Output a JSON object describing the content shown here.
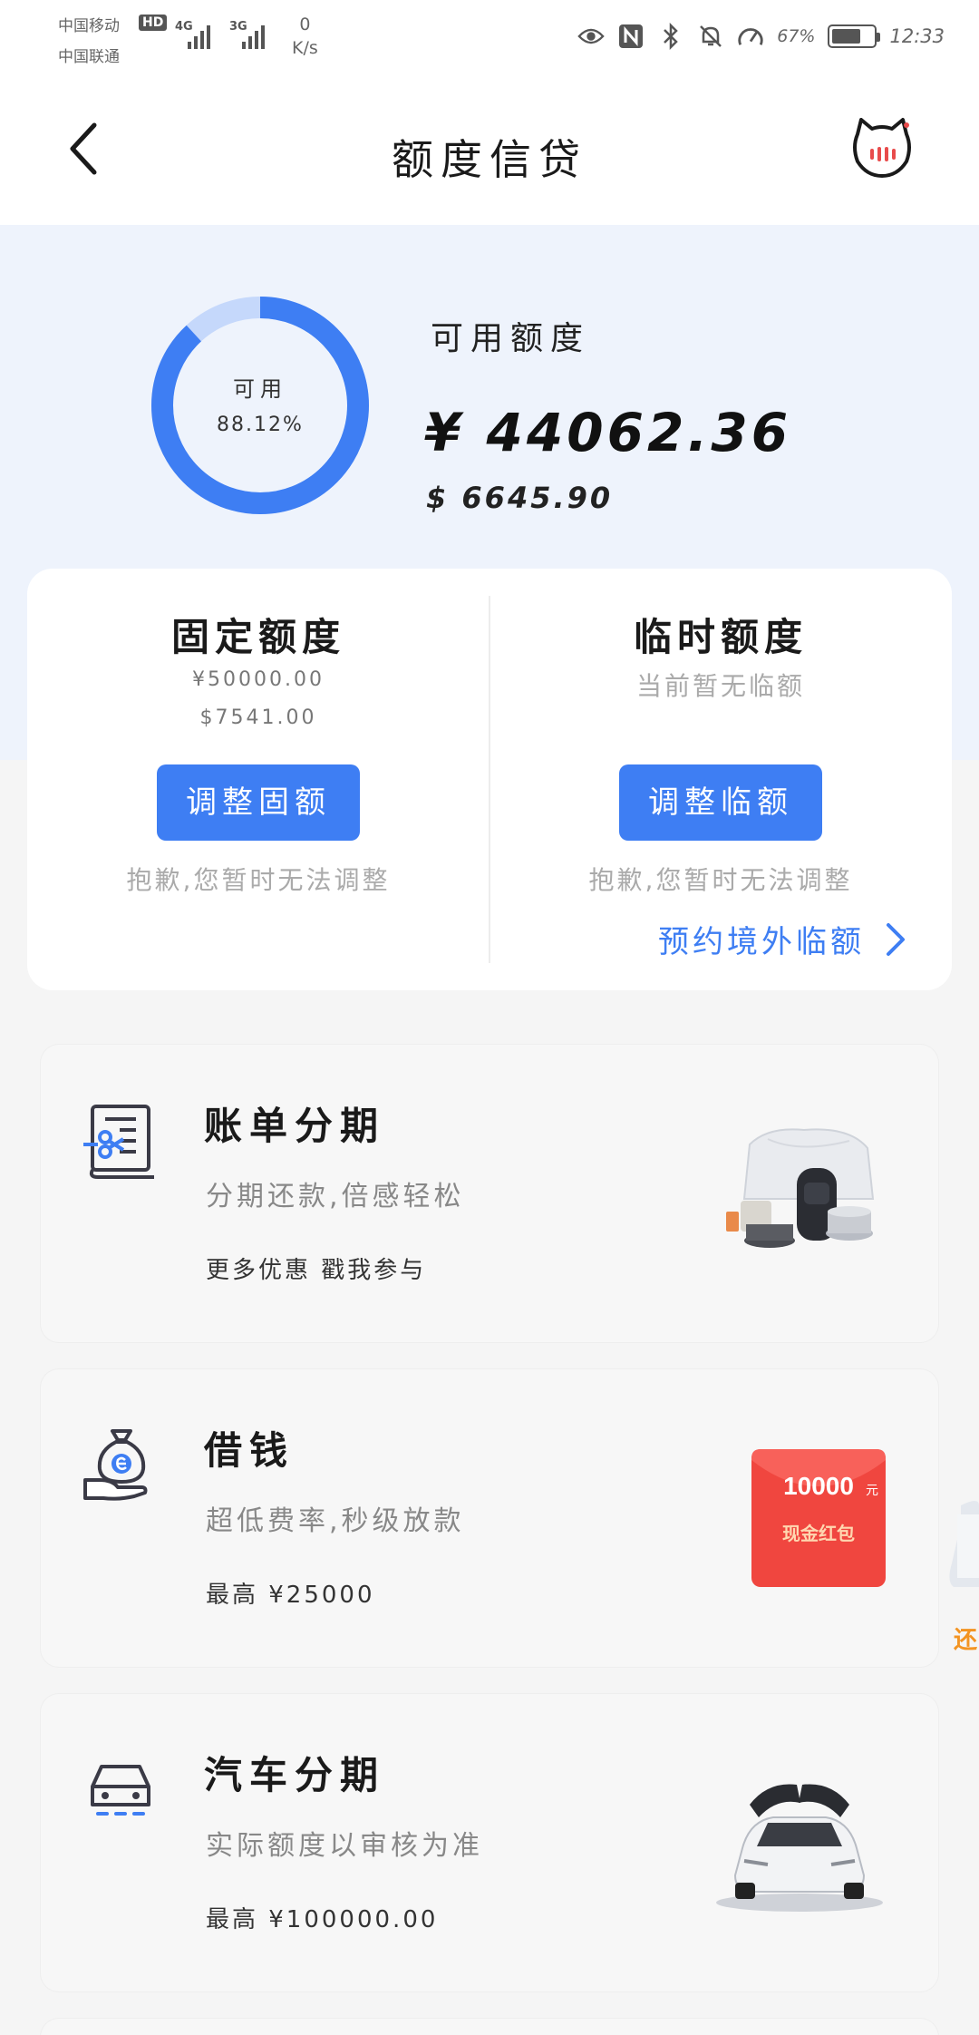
{
  "status_bar": {
    "carrier_1": "中国移动",
    "carrier_2": "中国联通",
    "hd_badge": "HD",
    "signal_1_label": "4G",
    "signal_2_label": "3G",
    "net_speed_value": "0",
    "net_speed_unit": "K/s",
    "battery_percent": "67%",
    "battery_level": 0.67,
    "time": "12:33",
    "icons": [
      "eye-icon",
      "nfc-icon",
      "bluetooth-icon",
      "mute-icon",
      "speed-icon",
      "battery-icon"
    ]
  },
  "header": {
    "title": "额度信贷",
    "back_icon": "chevron-left-icon",
    "mascot_icon": "cat-mascot-icon"
  },
  "summary": {
    "gauge_label": "可用",
    "gauge_percent": "88.12%",
    "gauge_value": 0.8812,
    "available_title": "可用额度",
    "available_cny": "¥ 44062.36",
    "available_usd": "$ 6645.90",
    "colors": {
      "accent": "#3e7ef3",
      "track": "#c5d8fb"
    }
  },
  "quota": {
    "fixed": {
      "title": "固定额度",
      "cny": "¥50000.00",
      "usd": "$7541.00",
      "button": "调整固额",
      "note": "抱歉,您暂时无法调整"
    },
    "temporary": {
      "title": "临时额度",
      "status": "当前暂无临额",
      "button": "调整临额",
      "note": "抱歉,您暂时无法调整",
      "overseas_link": "预约境外临额"
    }
  },
  "products": [
    {
      "title": "账单分期",
      "desc": "分期还款,倍感轻松",
      "meta": "更多优惠 戳我参与",
      "icon": "bill-installment-icon",
      "image": "home-goods-image"
    },
    {
      "title": "借钱",
      "desc": "超低费率,秒级放款",
      "meta": "最高 ¥25000",
      "icon": "money-bag-icon",
      "image": "red-envelope-image",
      "image_amount": "10000",
      "image_unit": "元",
      "image_caption": "现金红包"
    },
    {
      "title": "汽车分期",
      "desc": "实际额度以审核为准",
      "meta": "最高 ¥100000.00",
      "icon": "car-icon",
      "image": "car-image"
    }
  ],
  "side_peek_text": "还"
}
